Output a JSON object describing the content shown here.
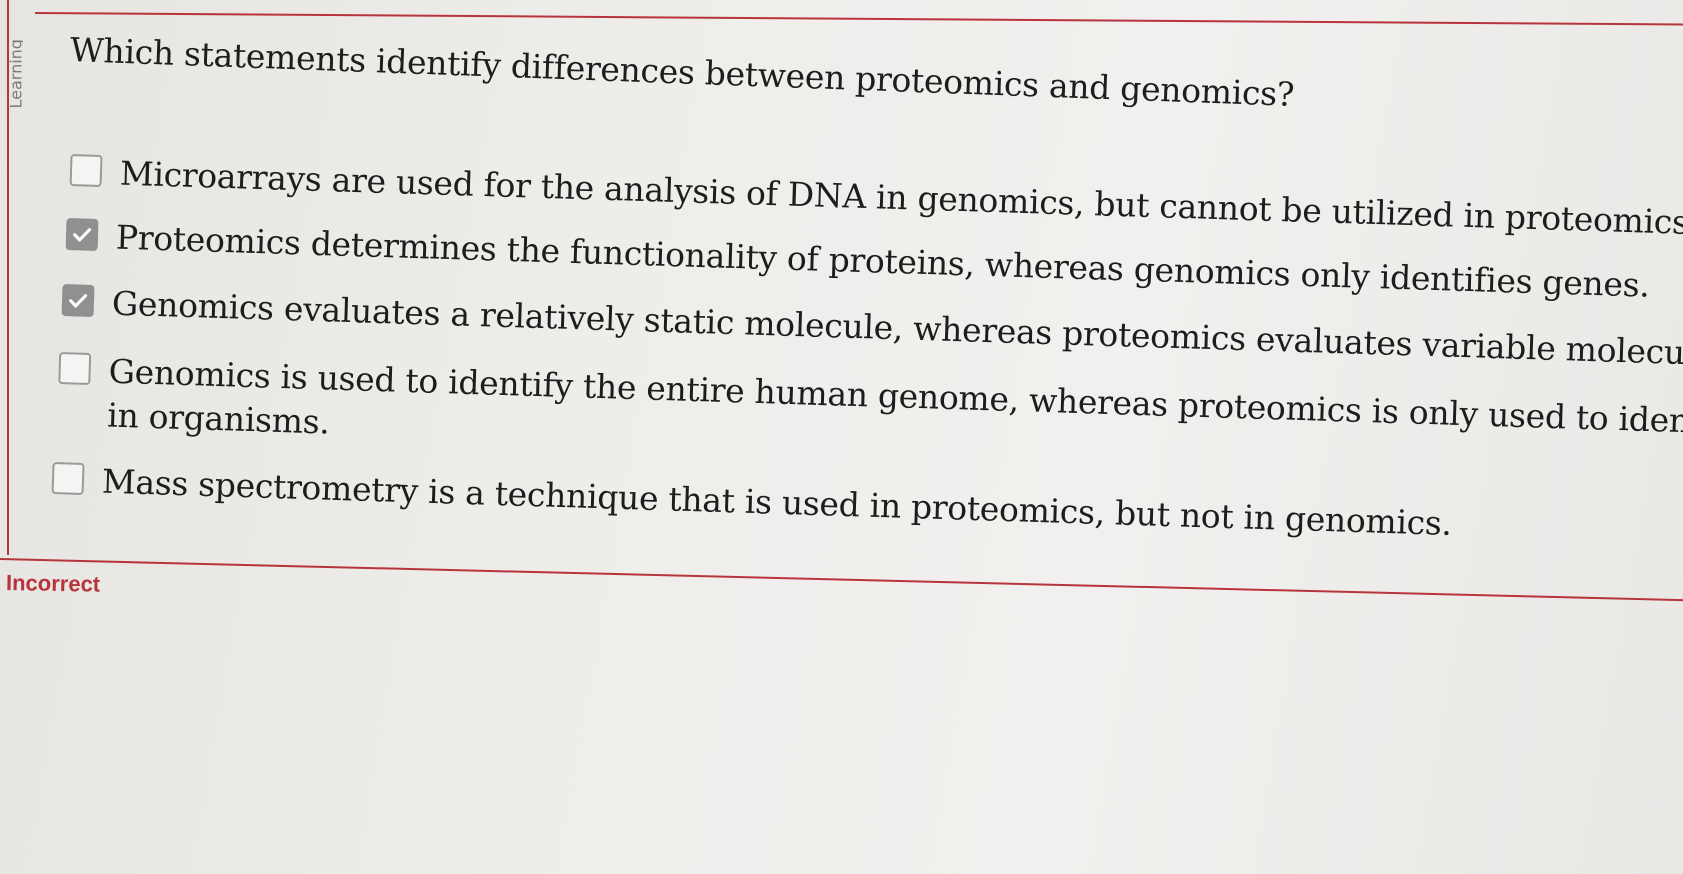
{
  "edge_label": "Learning",
  "question": "Which statements identify differences between proteomics and genomics?",
  "options": [
    {
      "text": "Microarrays are used for the analysis of DNA in genomics, but cannot be utilized in proteomics.",
      "checked": false
    },
    {
      "text": "Proteomics determines the functionality of proteins, whereas genomics only identifies genes.",
      "checked": true
    },
    {
      "text": "Genomics evaluates a relatively static molecule, whereas proteomics evaluates variable molecules.",
      "checked": true
    },
    {
      "text": "Genomics is used to identify the entire human genome, whereas proteomics is only used to identify spe",
      "text_line2": "in organisms.",
      "checked": false
    },
    {
      "text": "Mass spectrometry is a technique that is used in proteomics, but not in genomics.",
      "checked": false
    }
  ],
  "status": {
    "label": "Incorrect",
    "color": "#b8343c"
  },
  "icons": {
    "checked": "checkmark-icon"
  }
}
